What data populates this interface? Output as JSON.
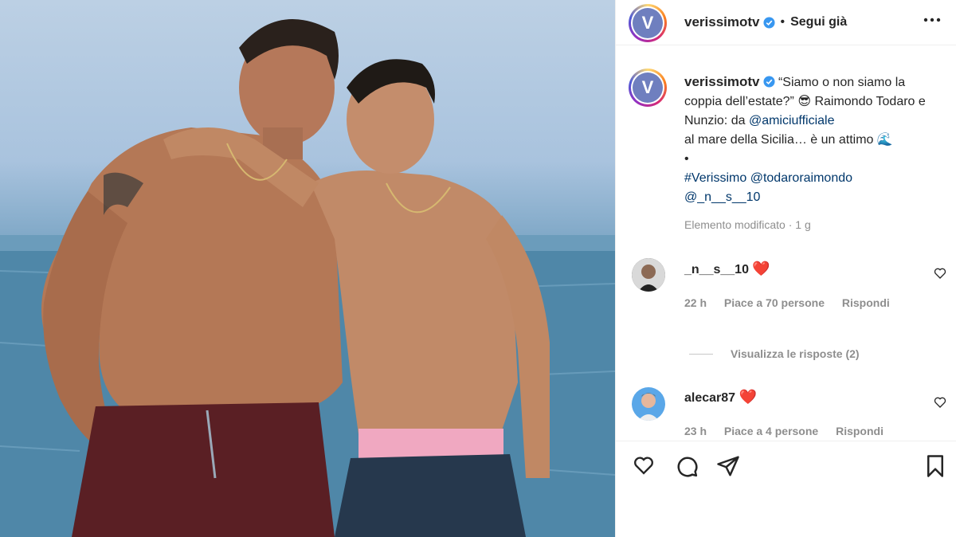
{
  "post": {
    "author": "verissimotv",
    "follow_status": "Segui già",
    "caption_text": "“Siamo o non siamo la coppia dell’estate?” 😎 Raimondo Todaro e Nunzio: da",
    "caption_mention": "@amiciufficiale",
    "caption_tail": "al mare della Sicilia… è un attimo 🌊",
    "caption_bullet": "•",
    "hashtag": "#Verissimo",
    "mention_2": "@todaroraimondo",
    "mention_3": "@_n__s__10",
    "meta": "Elemento modificato · 1 g",
    "avatar_letter": "V"
  },
  "comments": [
    {
      "user": "_n__s__10",
      "emoji": "❤️",
      "time": "22 h",
      "likes": "Piace a 70 persone",
      "reply": "Rispondi"
    },
    {
      "user": "alecar87",
      "emoji": "❤️",
      "time": "23 h",
      "likes": "Piace a 4 persone",
      "reply": "Rispondi"
    }
  ],
  "view_replies": "Visualizza le risposte (2)",
  "colors": {
    "link": "#00376b",
    "verified": "#3897f0",
    "heart": "#ed4956",
    "muted": "#8e8e8e"
  },
  "icons": [
    "more-icon",
    "verified-icon",
    "heart-icon",
    "comment-icon",
    "share-icon",
    "bookmark-icon"
  ]
}
